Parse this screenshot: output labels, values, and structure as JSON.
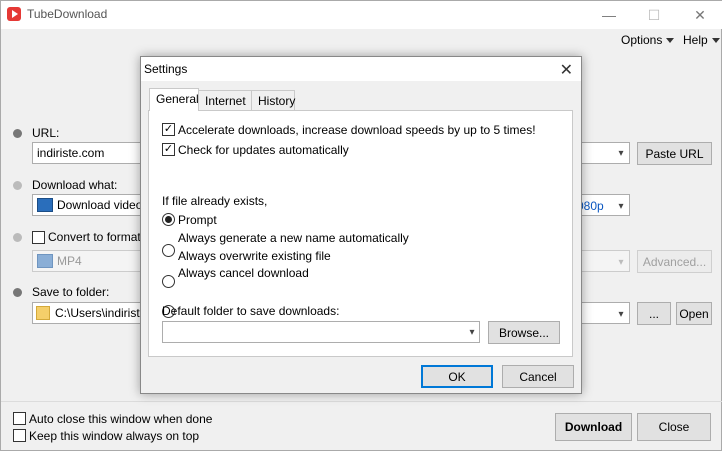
{
  "window": {
    "title": "TubeDownload",
    "menu": {
      "options": "Options",
      "help": "Help"
    },
    "controls": {
      "minimize": "—",
      "maximize": "☐",
      "close": "✕"
    }
  },
  "main": {
    "url_label": "URL:",
    "url_value": "indiriste.com",
    "paste_url": "Paste URL",
    "download_what_label": "Download what:",
    "download_what_value": "Download video",
    "quality_value": "080p",
    "convert_label": "Convert to format:",
    "format_value": "MP4",
    "advanced": "Advanced...",
    "save_label": "Save to folder:",
    "folder_value": "C:\\Users\\indiriste.",
    "browse_dots": "...",
    "open": "Open",
    "auto_close": "Auto close this window when done",
    "keep_on_top": "Keep this window always on top",
    "download": "Download",
    "close": "Close"
  },
  "dialog": {
    "title": "Settings",
    "close_glyph": "✕",
    "tabs": [
      "General",
      "Internet",
      "History"
    ],
    "accelerate": "Accelerate downloads, increase download speeds by up to 5 times!",
    "check_updates": "Check for updates automatically",
    "if_exists": "If file already exists,",
    "options": [
      "Prompt",
      "Always generate a new name automatically",
      "Always overwrite existing file",
      "Always cancel download"
    ],
    "default_folder_label": "Default folder to save downloads:",
    "default_folder_value": "",
    "browse": "Browse...",
    "ok": "OK",
    "cancel": "Cancel"
  }
}
